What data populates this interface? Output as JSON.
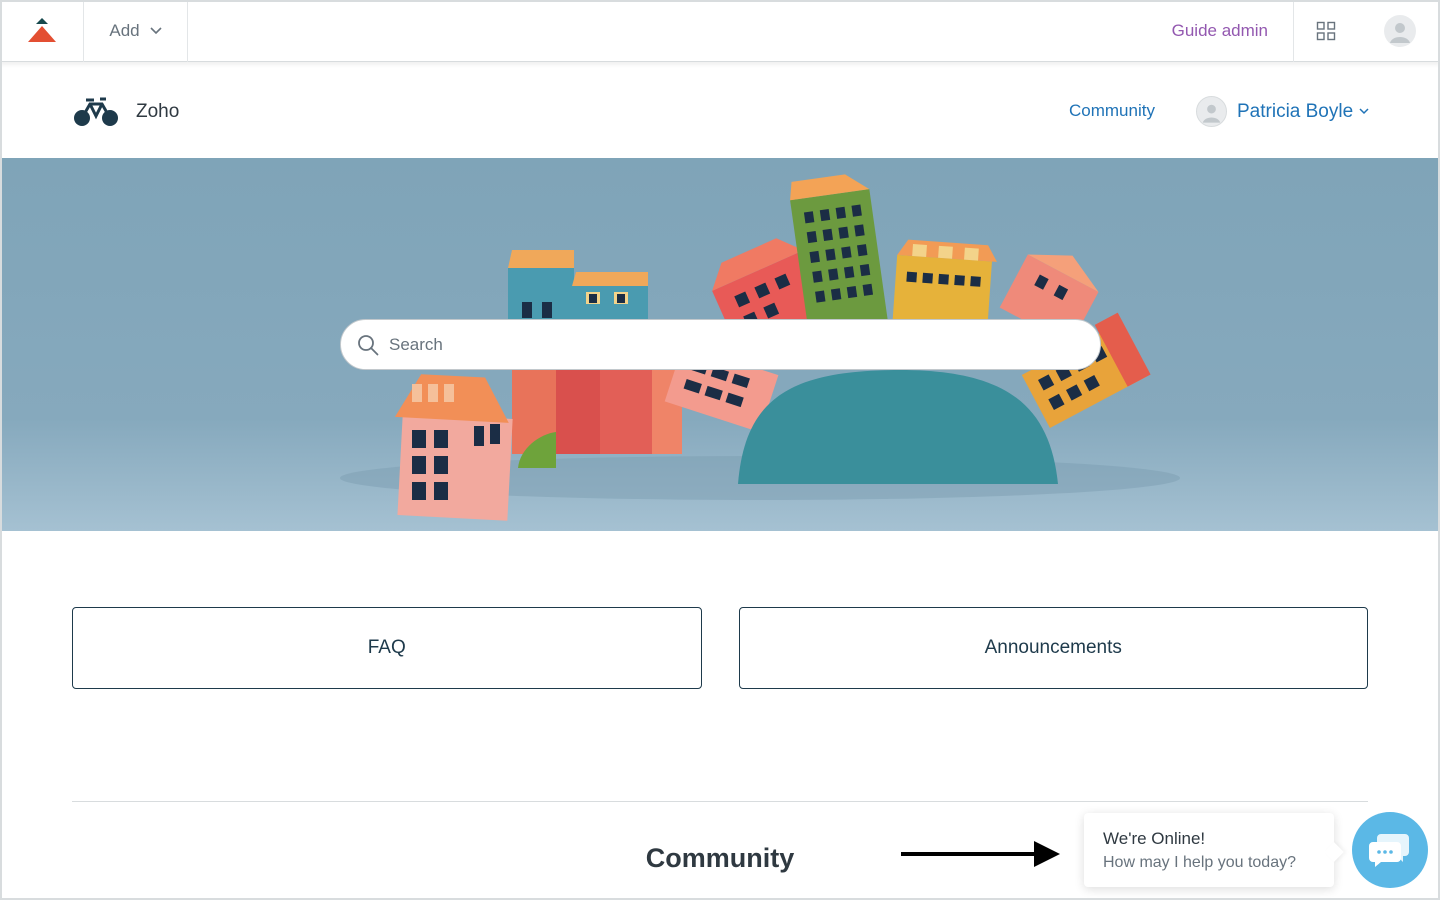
{
  "admin_bar": {
    "add_label": "Add",
    "guide_admin_label": "Guide admin"
  },
  "header": {
    "brand_name": "Zoho",
    "nav_community": "Community",
    "user_name": "Patricia Boyle"
  },
  "hero": {
    "search_placeholder": "Search"
  },
  "blocks": [
    {
      "label": "FAQ"
    },
    {
      "label": "Announcements"
    }
  ],
  "community_section": {
    "title": "Community"
  },
  "chat": {
    "title": "We're Online!",
    "subtitle": "How may I help you today?"
  },
  "colors": {
    "guide_admin": "#9358b0",
    "link": "#1f73b7",
    "hero_sky": "#7ea3b8",
    "chat_button": "#5bb8e6"
  }
}
